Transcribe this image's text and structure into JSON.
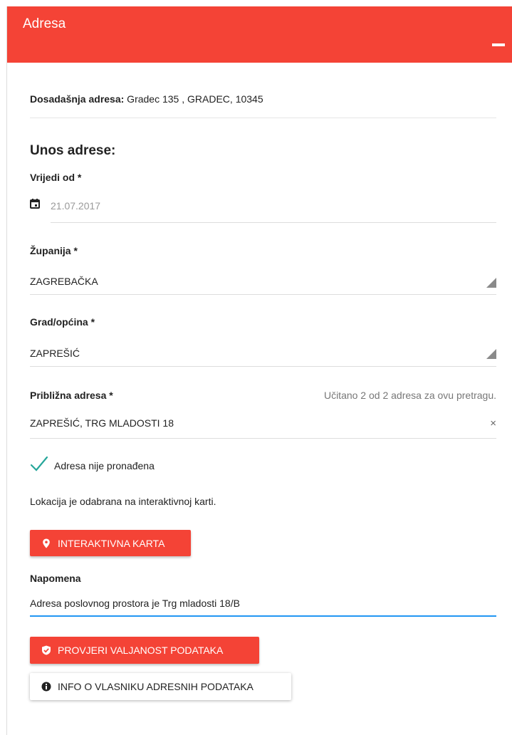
{
  "header": {
    "title": "Adresa"
  },
  "previous_address": {
    "label": "Dosadašnja adresa:",
    "value": " Gradec 135 , GRADEC, 10345"
  },
  "form": {
    "section_title": "Unos adrese:",
    "valid_from": {
      "label": "Vrijedi od *",
      "value": "21.07.2017",
      "icon": "calendar-icon"
    },
    "county": {
      "label": "Županija *",
      "value": "ZAGREBAČKA"
    },
    "city": {
      "label": "Grad/općina *",
      "value": "ZAPREŠIĆ"
    },
    "approx_address": {
      "label": "Približna adresa *",
      "hint": "Učitano 2 od 2 adresa za ovu pretragu.",
      "value": "ZAPREŠIĆ, TRG MLADOSTI 18",
      "clear": "×"
    },
    "not_found": {
      "label": "Adresa nije pronađena",
      "checked": true
    },
    "location_info": "Lokacija je odabrana na interaktivnoj karti.",
    "map_button": {
      "label": "INTERAKTIVNA KARTA",
      "icon": "map-pin-icon"
    },
    "note": {
      "label": "Napomena",
      "value": "Adresa poslovnog prostora je Trg mladosti 18/B"
    },
    "validate_button": {
      "label": "PROVJERI VALJANOST PODATAKA",
      "icon": "shield-check-icon"
    },
    "owner_info_button": {
      "label": "INFO O VLASNIKU ADRESNIH PODATAKA",
      "icon": "info-icon"
    }
  },
  "colors": {
    "accent": "#f44336",
    "focus": "#2196f3",
    "check": "#26a69a"
  }
}
